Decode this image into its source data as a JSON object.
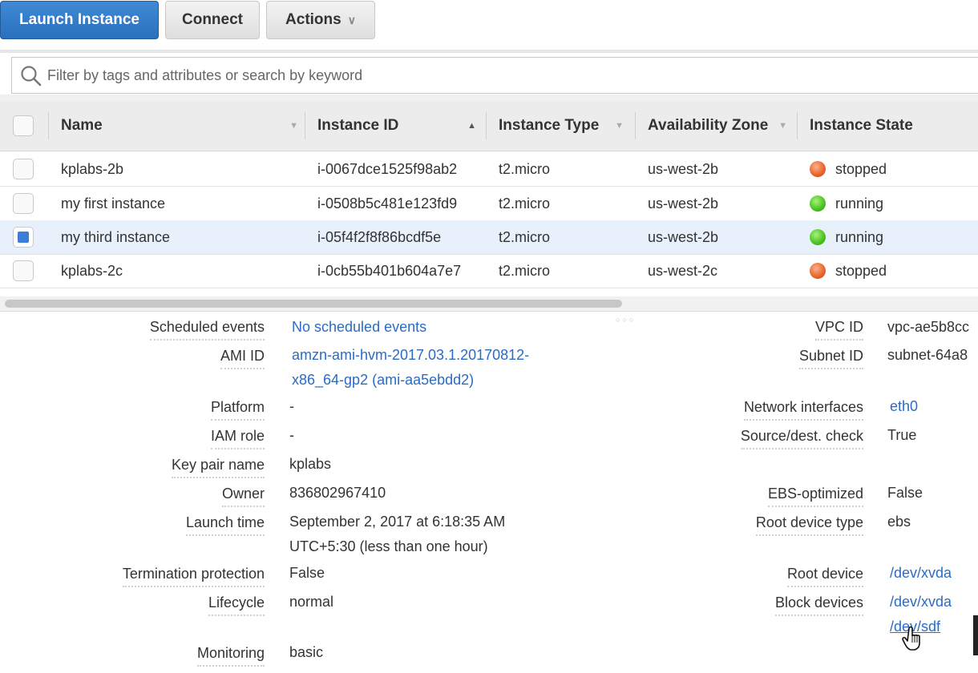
{
  "toolbar": {
    "launch_label": "Launch Instance",
    "connect_label": "Connect",
    "actions_label": "Actions",
    "caret": "∨"
  },
  "search": {
    "placeholder": "Filter by tags and attributes or search by keyword"
  },
  "columns": [
    "Name",
    "Instance ID",
    "Instance Type",
    "Availability Zone",
    "Instance State"
  ],
  "rows": [
    {
      "name": "kplabs-2b",
      "id": "i-0067dce1525f98ab2",
      "type": "t2.micro",
      "zone": "us-west-2b",
      "state": "stopped",
      "selected": false
    },
    {
      "name": "my first instance",
      "id": "i-0508b5c481e123fd9",
      "type": "t2.micro",
      "zone": "us-west-2b",
      "state": "running",
      "selected": false
    },
    {
      "name": "my third instance",
      "id": "i-05f4f2f8f86bcdf5e",
      "type": "t2.micro",
      "zone": "us-west-2b",
      "state": "running",
      "selected": true
    },
    {
      "name": "kplabs-2c",
      "id": "i-0cb55b401b604a7e7",
      "type": "t2.micro",
      "zone": "us-west-2c",
      "state": "stopped",
      "selected": false
    }
  ],
  "details": {
    "scheduled_events_label": "Scheduled events",
    "scheduled_events_value": "No scheduled events",
    "ami_id_label": "AMI ID",
    "ami_id_value_1": "amzn-ami-hvm-2017.03.1.20170812-",
    "ami_id_value_2": "x86_64-gp2 (ami-aa5ebdd2)",
    "platform_label": "Platform",
    "platform_value": "-",
    "iam_role_label": "IAM role",
    "iam_role_value": "-",
    "key_pair_label": "Key pair name",
    "key_pair_value": "kplabs",
    "owner_label": "Owner",
    "owner_value": "836802967410",
    "launch_time_label": "Launch time",
    "launch_time_value_1": "September 2, 2017 at 6:18:35 AM",
    "launch_time_value_2": "UTC+5:30 (less than one hour)",
    "termination_label": "Termination protection",
    "termination_value": "False",
    "lifecycle_label": "Lifecycle",
    "lifecycle_value": "normal",
    "monitoring_label": "Monitoring",
    "monitoring_value": "basic",
    "vpc_id_label": "VPC ID",
    "vpc_id_value": "vpc-ae5b8cc",
    "subnet_id_label": "Subnet ID",
    "subnet_id_value": "subnet-64a8",
    "network_interfaces_label": "Network interfaces",
    "network_interfaces_value": "eth0",
    "source_dest_label": "Source/dest. check",
    "source_dest_value": "True",
    "ebs_optimized_label": "EBS-optimized",
    "ebs_optimized_value": "False",
    "root_device_type_label": "Root device type",
    "root_device_type_value": "ebs",
    "root_device_label": "Root device",
    "root_device_value": "/dev/xvda",
    "block_devices_label": "Block devices",
    "block_devices_value_1": "/dev/xvda",
    "block_devices_value_2": "/dev/sdf"
  },
  "colors": {
    "primary": "#2a6fbc",
    "link": "#2a6cc4",
    "selected_row": "#e8f1fb",
    "running": "#45c21f",
    "stopped": "#e5632c"
  }
}
